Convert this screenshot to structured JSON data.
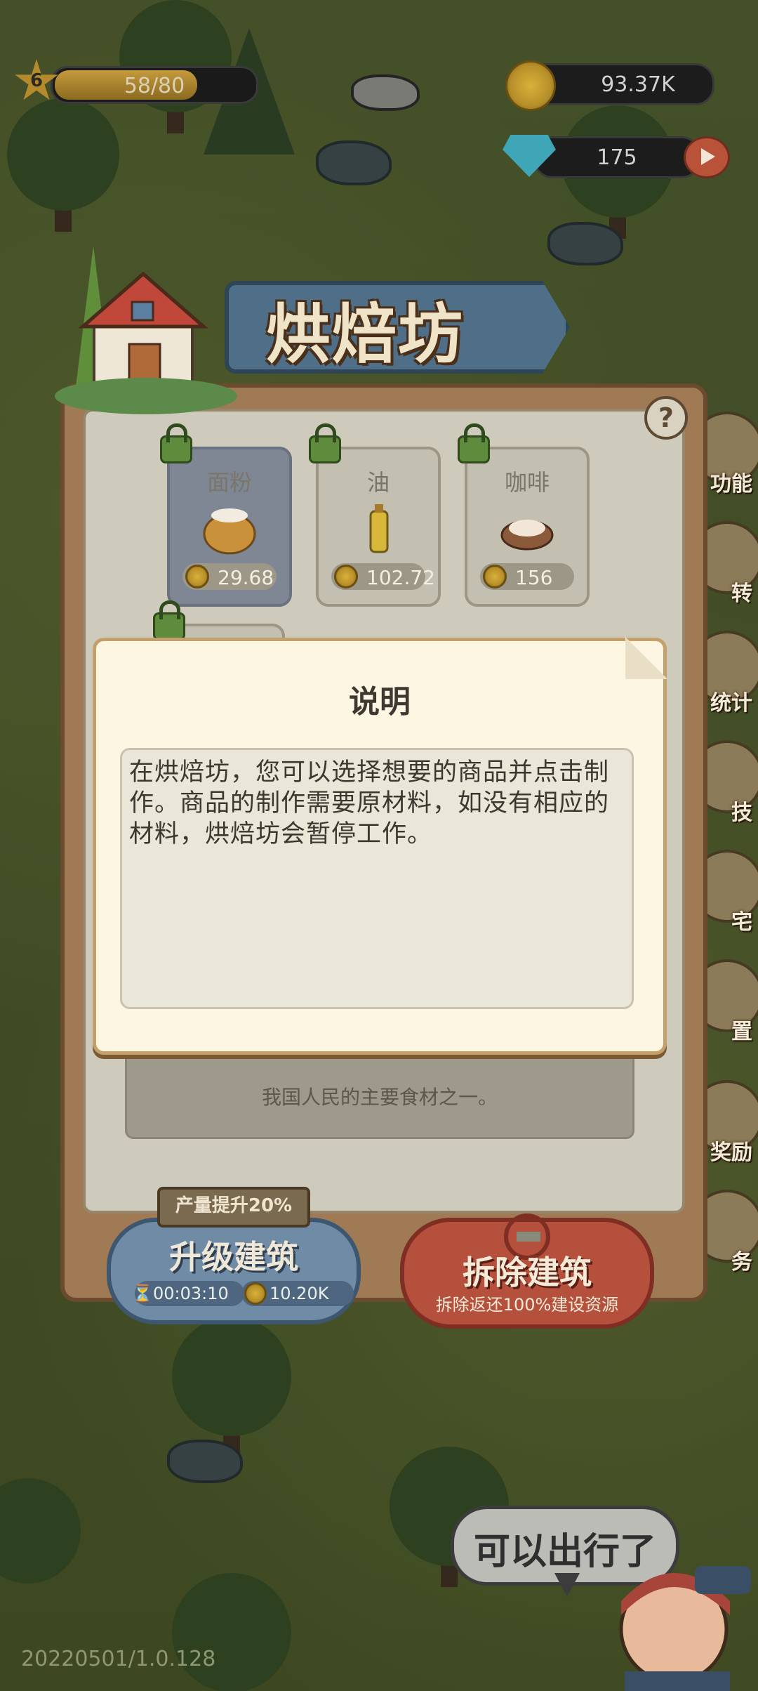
{
  "hud": {
    "level": "6",
    "xp_text": "58/80",
    "xp_fraction": 0.725,
    "coins": "93.37K",
    "gems": "175"
  },
  "side_menu": [
    {
      "label": "功能",
      "icon": "blocks-icon"
    },
    {
      "label": "转",
      "icon": "wheel-icon"
    },
    {
      "label": "统计",
      "icon": "clipboard-icon"
    },
    {
      "label": "技",
      "icon": "potion-icon"
    },
    {
      "label": "宅",
      "icon": "wrench-icon"
    },
    {
      "label": "置",
      "icon": "gear-icon"
    },
    {
      "label": "奖励",
      "icon": "reward-icon"
    },
    {
      "label": "务",
      "icon": "star-icon"
    }
  ],
  "building": {
    "title": "烘焙坊",
    "items": [
      {
        "name": "面粉",
        "price": "29.68",
        "icon": "flour-sack-icon",
        "selected": true
      },
      {
        "name": "油",
        "price": "102.72",
        "icon": "oil-bottle-icon",
        "selected": false
      },
      {
        "name": "咖啡",
        "price": "156",
        "icon": "coffee-cup-icon",
        "selected": false
      }
    ],
    "item_description": "我国人民的主要食材之一。"
  },
  "upgrade": {
    "boost_tag": "产量提升20%",
    "label": "升级建筑",
    "time": "00:03:10",
    "cost": "10.20K"
  },
  "demolish": {
    "label": "拆除建筑",
    "subtitle": "拆除返还100%建设资源"
  },
  "modal": {
    "title": "说明",
    "body": "在烘焙坊，您可以选择想要的商品并点击制作。商品的制作需要原材料，如没有相应的材料，烘焙坊会暂停工作。"
  },
  "speech_bubble": "可以出行了",
  "version": "20220501/1.0.128",
  "colors": {
    "accent_gold": "#c59a3d",
    "panel_brown": "#a07a55",
    "banner_blue": "#4f6f88",
    "demolish_red": "#b5503c",
    "upgrade_blue": "#6f8ba6"
  }
}
